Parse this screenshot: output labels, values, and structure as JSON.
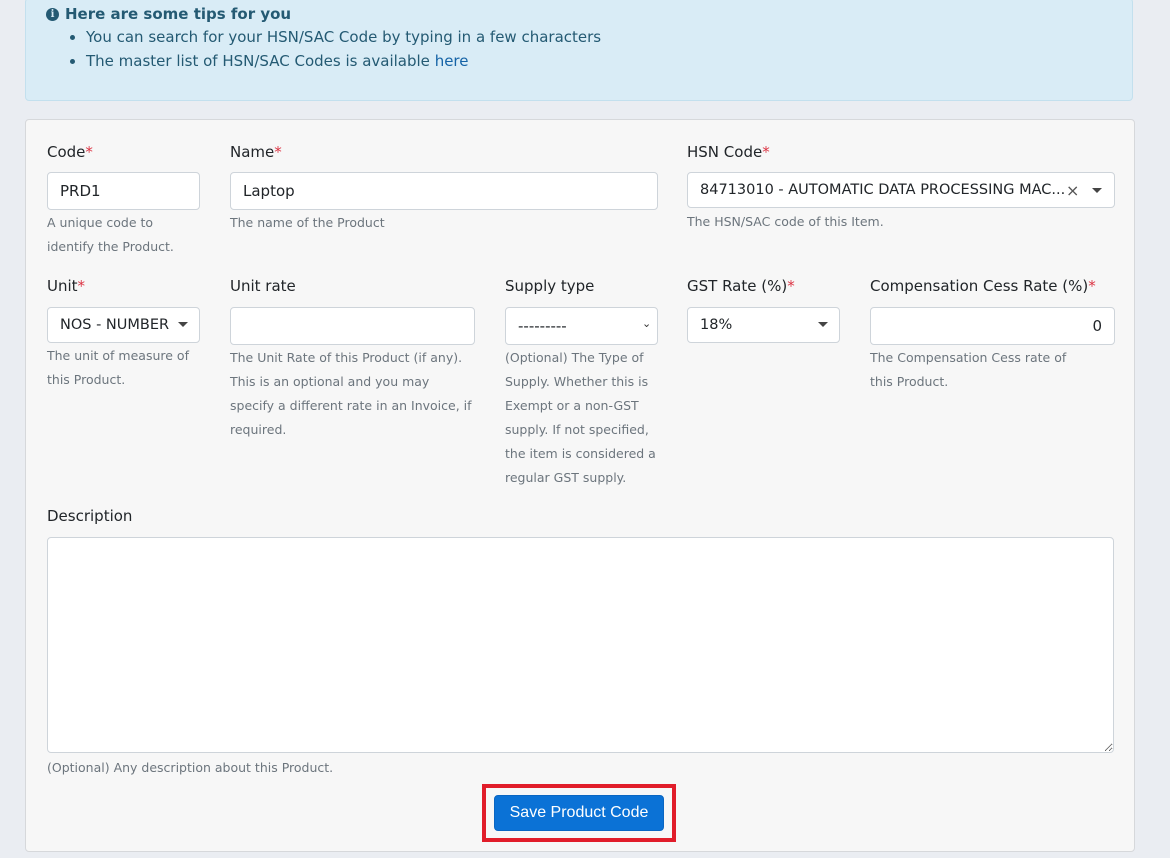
{
  "tips": {
    "title": "Here are some tips for you",
    "items": [
      "You can search for your HSN/SAC Code by typing in a few characters",
      "The master list of HSN/SAC Codes is available "
    ],
    "link_text": "here"
  },
  "form": {
    "code": {
      "label": "Code",
      "value": "PRD1",
      "help": "A unique code to identify the Product."
    },
    "name": {
      "label": "Name",
      "value": "Laptop",
      "help": "The name of the Product"
    },
    "hsn": {
      "label": "HSN Code",
      "value": "84713010 - AUTOMATIC DATA PROCESSING MAC...",
      "help": "The HSN/SAC code of this Item."
    },
    "unit": {
      "label": "Unit",
      "value": "NOS - NUMBER",
      "help": "The unit of measure of this Product."
    },
    "unit_rate": {
      "label": "Unit rate",
      "value": "",
      "help": "The Unit Rate of this Product (if any). This is an optional and you may specify a different rate in an Invoice, if required."
    },
    "supply_type": {
      "label": "Supply type",
      "value": "---------",
      "help": "(Optional) The Type of Supply. Whether this is Exempt or a non-GST supply. If not specified, the item is considered a regular GST supply."
    },
    "gst_rate": {
      "label": "GST Rate (%)",
      "value": "18%"
    },
    "cess_rate": {
      "label": "Compensation Cess Rate (%)",
      "value": "0",
      "help": "The Compensation Cess rate of this Product."
    },
    "description": {
      "label": "Description",
      "value": "",
      "help": "(Optional) Any description about this Product."
    },
    "required_mark": "*",
    "save_label": "Save Product Code"
  },
  "colors": {
    "accent": "#0b72d6",
    "highlight": "#e11d2a",
    "required": "#dc3545"
  }
}
